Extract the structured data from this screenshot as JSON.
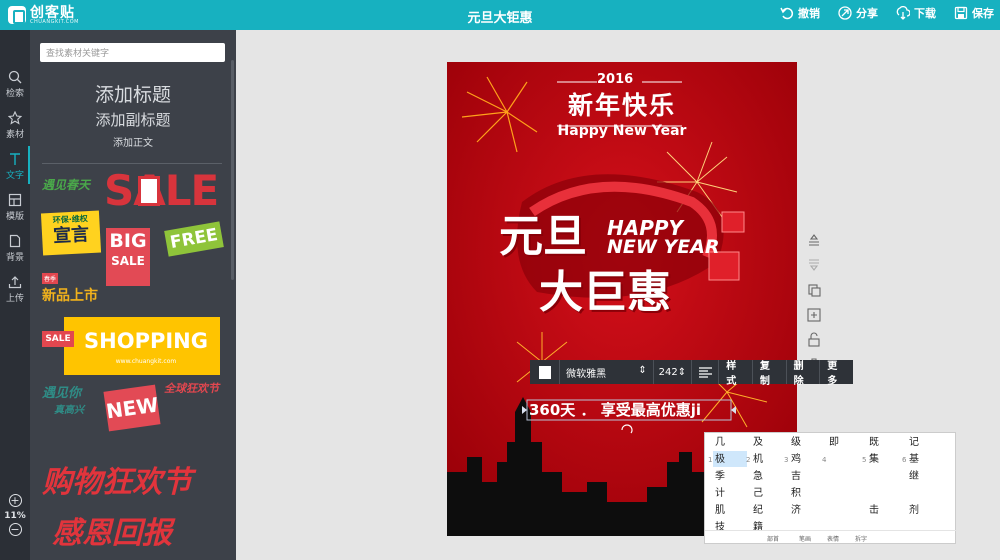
{
  "app": {
    "logo_name": "创客贴",
    "logo_url": "CHUANGKIT.COM",
    "doc_title": "元旦大钜惠",
    "accent": "#17b1c0"
  },
  "actions": [
    {
      "icon": "undo-icon",
      "label": "撤销"
    },
    {
      "icon": "share-icon",
      "label": "分享"
    },
    {
      "icon": "download-icon",
      "label": "下载"
    },
    {
      "icon": "save-icon",
      "label": "保存"
    }
  ],
  "rail": [
    {
      "icon": "search-icon",
      "label": "检索"
    },
    {
      "icon": "star-icon",
      "label": "素材"
    },
    {
      "icon": "text-icon",
      "label": "文字",
      "active": true
    },
    {
      "icon": "template-icon",
      "label": "模版"
    },
    {
      "icon": "background-icon",
      "label": "背景"
    },
    {
      "icon": "upload-icon",
      "label": "上传"
    }
  ],
  "zoom": {
    "plus": "+",
    "value": "11%",
    "minus": "−"
  },
  "panel": {
    "search_placeholder": "查找素材关键字",
    "add_title": "添加标题",
    "add_subtitle": "添加副标题",
    "add_body": "添加正文",
    "stickers": {
      "spring": "遇见春天",
      "sale": "SALE",
      "declaration_top": "环保·维权",
      "declaration": "宣言",
      "big": "BIG",
      "big_sale": "SALE",
      "free": "FREE",
      "new_product_tag": "春季",
      "new_product": "新品上市",
      "sale_small": "SALE",
      "shopping": "SHOPPING",
      "shopping_url": "www.chuangkit.com",
      "meet_you": "遇见你",
      "happy": "真高兴",
      "new": "NEW",
      "global_carnival": "全球狂欢节",
      "shopping_carnival": "购物狂欢节",
      "thanks_feedback": "感恩回报"
    }
  },
  "poster": {
    "year": "2016",
    "greeting": "新年快乐",
    "happy_new_year": "Happy New Year",
    "yuandan": "元旦",
    "big_deal": "大巨惠",
    "happy": "HAPPY",
    "new_year": "NEW YEAR",
    "selected_text": "360天 ． 享受最高优惠ji"
  },
  "side_tools": [
    {
      "icon": "bring-forward-icon"
    },
    {
      "icon": "send-backward-icon"
    },
    {
      "icon": "copy-layer-icon"
    },
    {
      "icon": "group-icon"
    },
    {
      "icon": "lock-icon"
    },
    {
      "icon": "delete-icon"
    }
  ],
  "toolbar": {
    "font": "微软雅黑",
    "size": "242",
    "style": "样式",
    "copy": "复制",
    "delete": "删除",
    "more": "更多"
  },
  "ime": {
    "rows": [
      [
        "几",
        "及",
        "级",
        "即",
        "既",
        "记"
      ],
      [
        "极",
        "机",
        "鸡",
        "",
        "集",
        "基"
      ],
      [
        "季",
        "急",
        "吉",
        "",
        "",
        "继"
      ],
      [
        "计",
        "己",
        "积",
        "",
        "",
        ""
      ],
      [
        "肌",
        "纪",
        "济",
        "",
        "击",
        "剂"
      ],
      [
        "技",
        "籍",
        "",
        "",
        "",
        ""
      ]
    ],
    "nums": [
      "1",
      "2",
      "3",
      "4",
      "5",
      "6"
    ],
    "footer": [
      "部首",
      "笔画",
      "表情",
      "拆字"
    ]
  }
}
